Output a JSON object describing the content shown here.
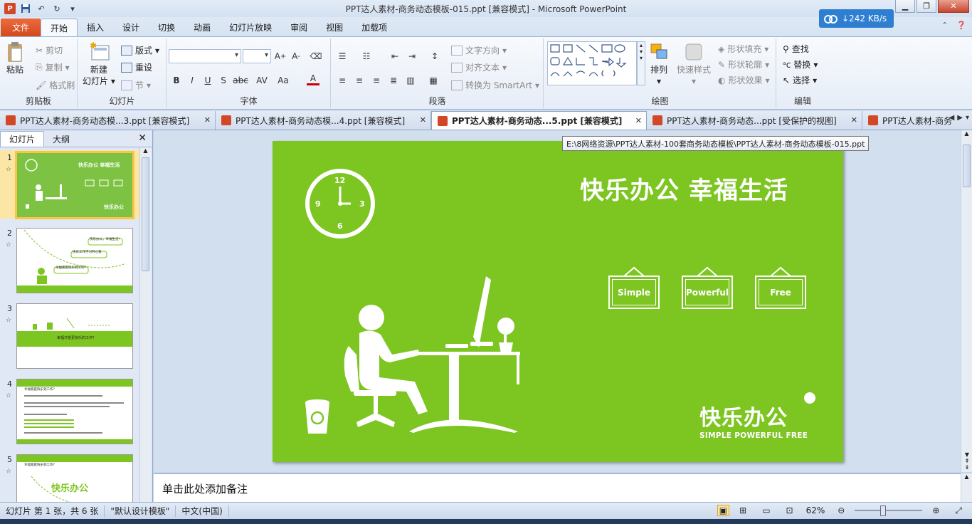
{
  "window": {
    "title": "PPT达人素材-商务动态模板-015.ppt [兼容模式]  -  Microsoft PowerPoint",
    "net_speed": "↓242 KB/s"
  },
  "ribbon_tabs": {
    "file": "文件",
    "tabs": [
      "开始",
      "插入",
      "设计",
      "切换",
      "动画",
      "幻灯片放映",
      "审阅",
      "视图",
      "加载项"
    ]
  },
  "ribbon": {
    "clipboard": {
      "paste": "粘贴",
      "cut": "剪切",
      "copy": "复制",
      "format_painter": "格式刷",
      "label": "剪贴板"
    },
    "slides": {
      "new_slide": "新建",
      "new_slide2": "幻灯片",
      "layout": "版式",
      "reset": "重设",
      "section": "节",
      "label": "幻灯片"
    },
    "font": {
      "label": "字体"
    },
    "paragraph": {
      "text_direction": "文字方向",
      "align_text": "对齐文本",
      "convert_smartart": "转换为 SmartArt",
      "label": "段落"
    },
    "drawing": {
      "arrange": "排列",
      "quick_styles": "快速样式",
      "shape_fill": "形状填充",
      "shape_outline": "形状轮廓",
      "shape_effects": "形状效果",
      "label": "绘图"
    },
    "editing": {
      "find": "查找",
      "replace": "替换",
      "select": "选择",
      "label": "编辑"
    }
  },
  "doc_tabs": [
    {
      "label": "PPT达人素材-商务动态模...3.ppt [兼容模式]",
      "active": false
    },
    {
      "label": "PPT达人素材-商务动态模...4.ppt [兼容模式]",
      "active": false
    },
    {
      "label": "PPT达人素材-商务动态...5.ppt [兼容模式]",
      "active": true
    },
    {
      "label": "PPT达人素材-商务动态...ppt [受保护的视图]",
      "active": false
    },
    {
      "label": "PPT达人素材-商务",
      "active": false
    }
  ],
  "tooltip": "E:\\8网络资源\\PPT达人素材-100套商务动态模板\\PPT达人素材-商务动态模板-015.ppt",
  "left_pane": {
    "tab_slides": "幻灯片",
    "tab_outline": "大纲",
    "slides": [
      {
        "num": "1",
        "title": "快乐办公   幸福生活"
      },
      {
        "num": "2",
        "bubbles": [
          "快乐办公，幸福生活！",
          "快乐工作学习开心我",
          "幸福家庭快乐到工作？"
        ]
      },
      {
        "num": "3",
        "caption": "幸福才能更快乐的工作？"
      },
      {
        "num": "4",
        "heading": "幸福家庭快乐到工作？"
      },
      {
        "num": "5",
        "heading": "幸福家庭快乐到工作？",
        "logo": "快乐办公"
      }
    ]
  },
  "slide": {
    "title": "快乐办公   幸福生活",
    "clock_numbers": [
      "12",
      "3",
      "6",
      "9"
    ],
    "frames": [
      "Simple",
      "Powerful",
      "Free"
    ],
    "logo_text": "快乐办公",
    "logo_tagline": "SIMPLE POWERFUL FREE",
    "bg_color": "#7dc521"
  },
  "notes_placeholder": "单击此处添加备注",
  "status": {
    "slide_pos": "幻灯片 第 1 张，共 6 张",
    "theme": "\"默认设计模板\"",
    "language": "中文(中国)",
    "zoom": "62%"
  }
}
